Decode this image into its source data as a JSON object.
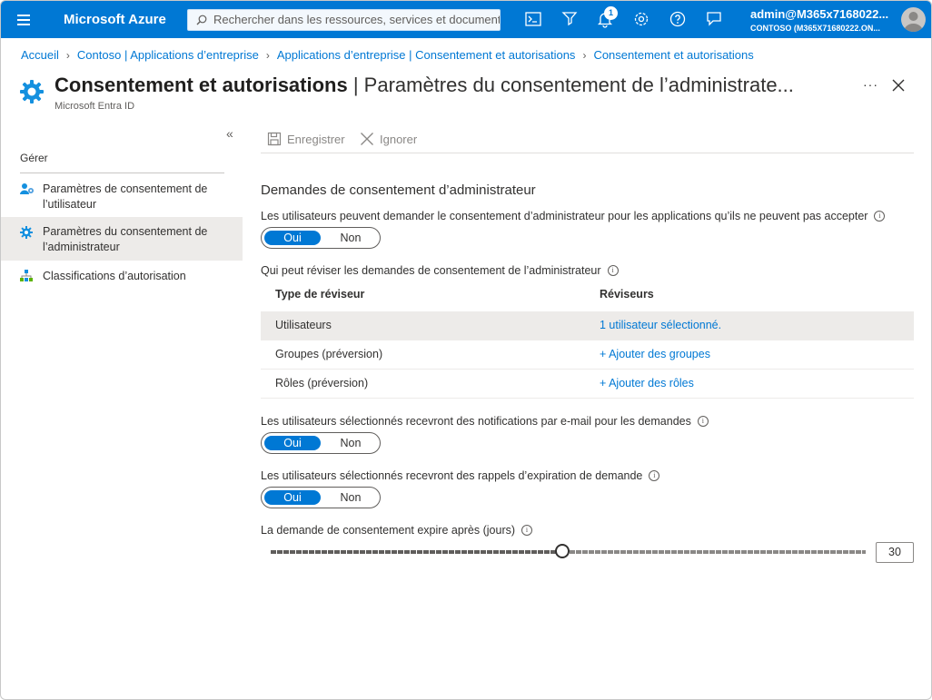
{
  "topbar": {
    "brand": "Microsoft Azure",
    "search_placeholder": "Rechercher dans les ressources, services et documents (G+/)",
    "notification_count": "1",
    "account_name": "admin@M365x7168022...",
    "account_tenant": "CONTOSO (M365X71680222.ON...",
    "accent": "#0078d4"
  },
  "breadcrumb": [
    "Accueil",
    "Contoso | Applications d’entreprise",
    "Applications d’entreprise | Consentement et autorisations",
    "Consentement et autorisations"
  ],
  "header": {
    "title_bold": "Consentement et autorisations",
    "title_rest": " | Paramètres du consentement de l’administrate...",
    "subtitle": "Microsoft Entra ID",
    "more": "···"
  },
  "sidebar": {
    "heading": "Gérer",
    "items": [
      {
        "label": "Paramètres de consentement de l’utilisateur",
        "icon": "users-gear-icon",
        "selected": false
      },
      {
        "label": "Paramètres du consentement de l’administrateur",
        "icon": "gear-icon",
        "selected": true
      },
      {
        "label": "Classifications d’autorisation",
        "icon": "hierarchy-icon",
        "selected": false
      }
    ]
  },
  "toolbar": {
    "save_label": "Enregistrer",
    "discard_label": "Ignorer"
  },
  "main": {
    "section_title": "Demandes de consentement d’administrateur",
    "q1": "Les utilisateurs peuvent demander le consentement d’administrateur pour les applications qu’ils ne peuvent pas accepter",
    "q2": "Qui peut réviser les demandes de consentement de l’administrateur",
    "q3": "Les utilisateurs sélectionnés recevront des notifications par e-mail pour les demandes",
    "q4": "Les utilisateurs sélectionnés recevront des rappels d’expiration de demande",
    "q5": "La demande de consentement expire après (jours)",
    "toggle_on": "Oui",
    "toggle_off": "Non",
    "table": {
      "headers": [
        "Type de réviseur",
        "Réviseurs"
      ],
      "rows": [
        {
          "type": "Utilisateurs",
          "reviewers": "1 utilisateur sélectionné."
        },
        {
          "type": "Groupes (préversion)",
          "reviewers": "+ Ajouter des groupes"
        },
        {
          "type": "Rôles (préversion)",
          "reviewers": "+ Ajouter des rôles"
        }
      ]
    },
    "expiry_days": "30",
    "slider_fraction": 0.49
  }
}
